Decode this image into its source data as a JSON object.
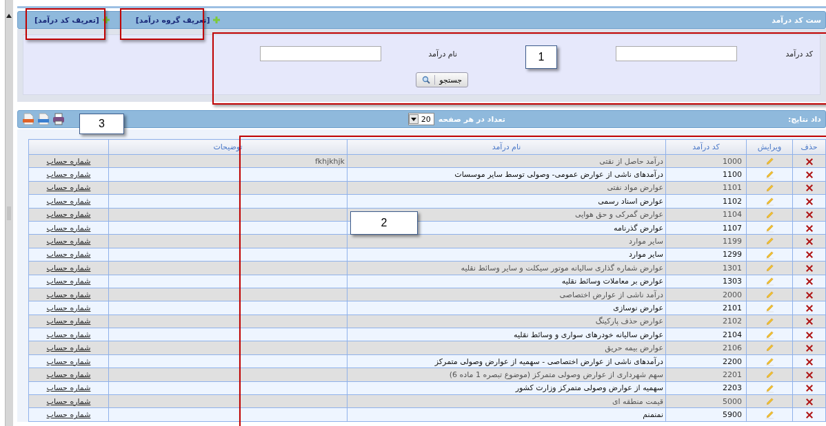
{
  "panel": {
    "title": "ست کد درآمد",
    "links": [
      {
        "label": "[تعریف گروه درآمد]"
      },
      {
        "label": "[تعریف کد درآمد]"
      }
    ]
  },
  "search": {
    "fields": [
      {
        "label": "کد درآمد"
      },
      {
        "label": "نام درآمد"
      }
    ],
    "button": "جستجو"
  },
  "results_bar": {
    "count_label": "داد نتایج:",
    "page_size_label": "تعداد در هر صفحه",
    "page_size": "20"
  },
  "table": {
    "columns": [
      "حذف",
      "ویرایش",
      "کد درآمد",
      "نام درآمد",
      "توضیحات"
    ],
    "rows": [
      {
        "code": "1000",
        "name": "درآمد حاصل از نقتی",
        "description": "fkhjkhjk",
        "link": "شماره حساب"
      },
      {
        "code": "1100",
        "name": "درآمدهای ناشی از عوارض عمومی- وصولی توسط سایر موسسات",
        "link": "شماره حساب"
      },
      {
        "code": "1101",
        "name": "عوارض مواد نفتی",
        "link": "شماره حساب"
      },
      {
        "code": "1102",
        "name": "عوارض اسناد رسمی",
        "link": "شماره حساب"
      },
      {
        "code": "1104",
        "name": "عوارض گمرکی و حق هوایی",
        "link": "شماره حساب"
      },
      {
        "code": "1107",
        "name": "عوارض گذرنامه",
        "link": "شماره حساب"
      },
      {
        "code": "1199",
        "name": "سایر موارد",
        "link": "شماره حساب"
      },
      {
        "code": "1299",
        "name": "سایر موارد",
        "link": "شماره حساب"
      },
      {
        "code": "1301",
        "name": "عوارض شماره گذاری سالیانه موتور سیکلت و سایر وسائط نقلیه",
        "link": "شماره حساب"
      },
      {
        "code": "1303",
        "name": "عوارض بر معاملات وسائط نقلیه",
        "link": "شماره حساب"
      },
      {
        "code": "2000",
        "name": "درآمد ناشی از عوارض اختصاصی",
        "link": "شماره حساب"
      },
      {
        "code": "2101",
        "name": "عوارض نوسازی",
        "link": "شماره حساب"
      },
      {
        "code": "2102",
        "name": "عوارض حذف پارکینگ",
        "link": "شماره حساب"
      },
      {
        "code": "2104",
        "name": "عوارض سالیانه خودرهای سواری و وسائط نقلیه",
        "link": "شماره حساب"
      },
      {
        "code": "2106",
        "name": "عوارض بیمه حریق",
        "link": "شماره حساب"
      },
      {
        "code": "2200",
        "name": "درآمدهای ناشی از عوارض اختصاصی - سهمیه از عوارض وصولی متمرکز",
        "link": "شماره حساب"
      },
      {
        "code": "2201",
        "name": "سهم شهرداری از عوارض وصولی متمرکز (موضوع تبصره 1 ماده 6)",
        "link": "شماره حساب"
      },
      {
        "code": "2203",
        "name": "سهمیه از عوارض وصولی متمرکز وزارت کشور",
        "link": "شماره حساب"
      },
      {
        "code": "5000",
        "name": "قیمت منطقه ای",
        "link": "شماره حساب"
      },
      {
        "code": "5900",
        "name": "نمنمنم",
        "link": "شماره حساب"
      }
    ]
  },
  "annotations": [
    {
      "label": "1"
    },
    {
      "label": "2"
    },
    {
      "label": "3"
    }
  ]
}
